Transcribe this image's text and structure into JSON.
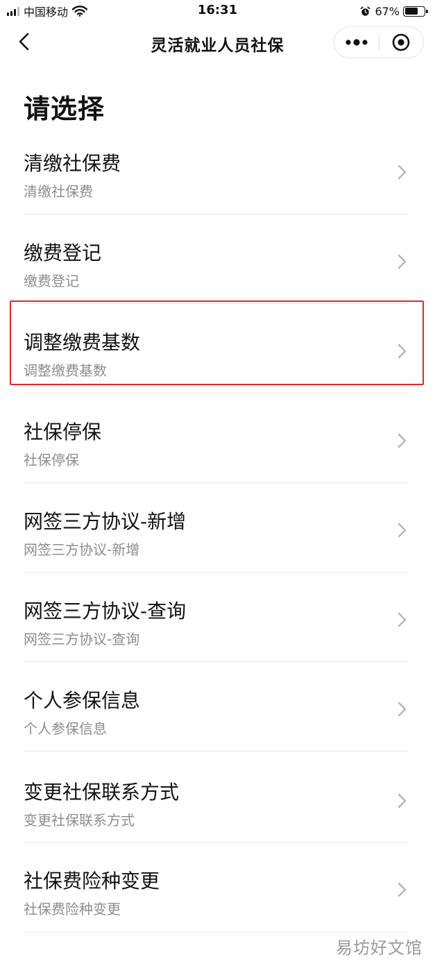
{
  "status_bar": {
    "carrier": "中国移动",
    "time": "16:31",
    "battery_percent": "67%",
    "battery_level": 0.67,
    "icons": [
      "signal-icon",
      "wifi-icon",
      "alarm-icon",
      "battery-icon"
    ]
  },
  "nav": {
    "title": "灵活就业人员社保",
    "back_icon": "chevron-left-icon",
    "more_icon": "more-dots-icon",
    "close_icon": "target-circle-icon"
  },
  "page": {
    "title": "请选择"
  },
  "menu": [
    {
      "title": "清缴社保费",
      "subtitle": "清缴社保费"
    },
    {
      "title": "缴费登记",
      "subtitle": "缴费登记"
    },
    {
      "title": "调整缴费基数",
      "subtitle": "调整缴费基数",
      "highlighted": true
    },
    {
      "title": "社保停保",
      "subtitle": "社保停保"
    },
    {
      "title": "网签三方协议-新增",
      "subtitle": "网签三方协议-新增"
    },
    {
      "title": "网签三方协议-查询",
      "subtitle": "网签三方协议-查询"
    },
    {
      "title": "个人参保信息",
      "subtitle": "个人参保信息"
    },
    {
      "title": "变更社保联系方式",
      "subtitle": "变更社保联系方式"
    },
    {
      "title": "社保费险种变更",
      "subtitle": "社保费险种变更"
    }
  ],
  "watermark": "易坊好文馆",
  "colors": {
    "highlight": "#e0292b",
    "subtitle": "#8d8d8d",
    "divider": "#e6e6e6"
  }
}
